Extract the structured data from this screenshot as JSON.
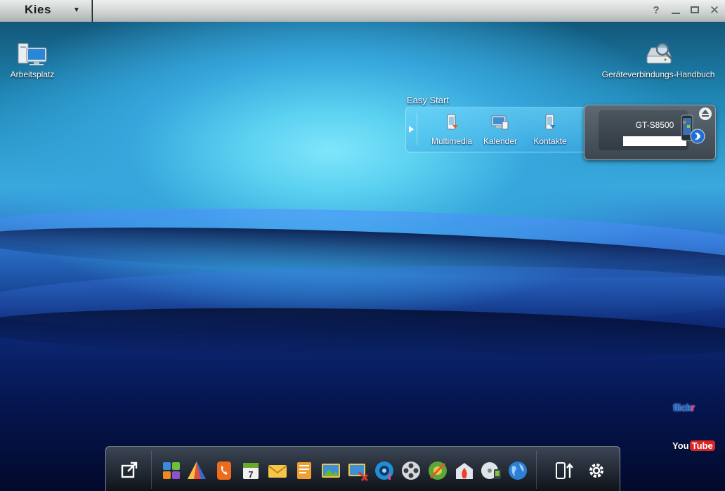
{
  "app": {
    "logo": "Kies"
  },
  "titlebar": {
    "help_icon": "question-icon",
    "minimize_icon": "minimize-icon",
    "maximize_icon": "maximize-icon",
    "close_icon": "close-icon"
  },
  "desktop": {
    "icons": [
      {
        "label": "Arbeitsplatz",
        "icon": "computer-icon"
      },
      {
        "label": "Geräteverbindungs-Handbuch",
        "icon": "drive-magnifier-icon"
      }
    ]
  },
  "easy_start": {
    "title": "Easy Start",
    "items": [
      {
        "label": "Multimedia",
        "icon": "phone-media-icon"
      },
      {
        "label": "Kalender",
        "icon": "calendar-sync-icon"
      },
      {
        "label": "Kontakte",
        "icon": "phone-contacts-icon"
      }
    ]
  },
  "device": {
    "name": "GT-S8500",
    "status_icon": "bluetooth-icon"
  },
  "services": {
    "flickr_a": "flick",
    "flickr_b": "r",
    "youtube_a": "You",
    "youtube_b": "Tube"
  },
  "dock": {
    "items": [
      "export-icon",
      "apps-icon",
      "music-pyramid-icon",
      "phone-icon",
      "calendar-icon",
      "mail-icon",
      "memo-icon",
      "photo-icon",
      "photo-edit-icon",
      "music-disc-icon",
      "film-reel-icon",
      "video-edit-icon",
      "burn-icon",
      "dvd-icon",
      "globe-icon",
      "phone-transfer-icon",
      "settings-icon"
    ]
  },
  "colors": {
    "accent": "#3aa9de",
    "dock": "#1a2026",
    "titlebar": "#d5dad9"
  }
}
